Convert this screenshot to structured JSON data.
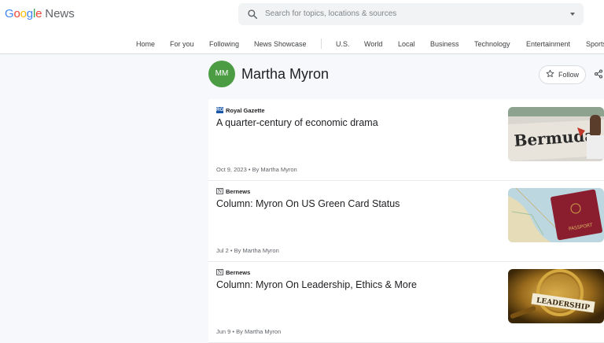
{
  "app": {
    "logo_google": "Google",
    "logo_news": "News"
  },
  "search": {
    "placeholder": "Search for topics, locations & sources"
  },
  "nav": {
    "items": [
      "Home",
      "For you",
      "Following",
      "News Showcase",
      "U.S.",
      "World",
      "Local",
      "Business",
      "Technology",
      "Entertainment",
      "Sports"
    ]
  },
  "author": {
    "initials": "MM",
    "name": "Martha Myron",
    "follow_label": "Follow"
  },
  "articles": [
    {
      "source": "Royal Gazette",
      "title": "A quarter-century of economic drama",
      "meta": "Oct 9, 2023 • By Martha Myron",
      "thumb": "bermuda-sign-image",
      "thumb_text": "Bermuda"
    },
    {
      "source": "Bernews",
      "title": "Column: Myron On US Green Card Status",
      "meta": "Jul 2 • By Martha Myron",
      "thumb": "map-passport-image",
      "thumb_text": "PASSPORT"
    },
    {
      "source": "Bernews",
      "title": "Column: Myron On Leadership, Ethics & More",
      "meta": "Jun 9 • By Martha Myron",
      "thumb": "leadership-magnifier-image",
      "thumb_text": "LEADERSHIP"
    }
  ],
  "colors": {
    "avatar": "#4c9c44",
    "google_blue": "#4285f4",
    "google_red": "#ea4335",
    "google_yellow": "#fbbc05",
    "google_green": "#34a853"
  }
}
